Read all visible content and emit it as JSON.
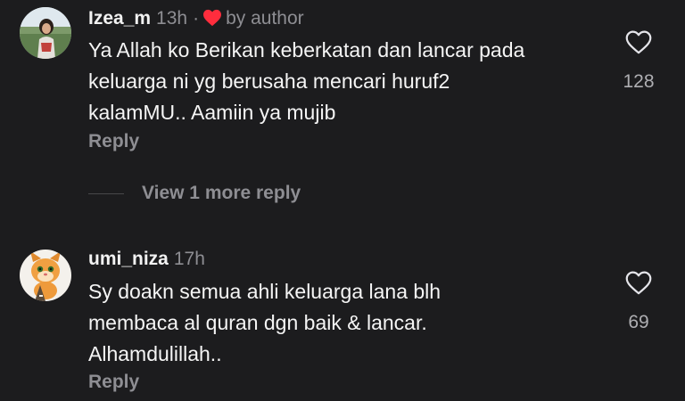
{
  "comments": [
    {
      "username": "Izea_m",
      "time": "13h",
      "separator": "·",
      "author_badge": "by author",
      "text_lines": [
        "Ya Allah ko Berikan keberkatan dan lancar pada",
        "keluarga ni yg berusaha mencari huruf2",
        "kalamMU.. Aamiin ya mujib"
      ],
      "reply_label": "Reply",
      "likes": "128",
      "view_more": "View 1 more reply"
    },
    {
      "username": "umi_niza",
      "time": "17h",
      "text_lines": [
        "Sy doakn semua ahli keluarga lana blh",
        "membaca al quran dgn baik & lancar.",
        "Alhamdulillah.."
      ],
      "reply_label": "Reply",
      "likes": "69"
    }
  ],
  "colors": {
    "background": "#1c1c1e",
    "secondary_text": "#8e8e93",
    "author_heart": "#ff2d3d"
  },
  "icons": {
    "like": "heart-outline-icon",
    "author": "heart-filled-icon"
  }
}
